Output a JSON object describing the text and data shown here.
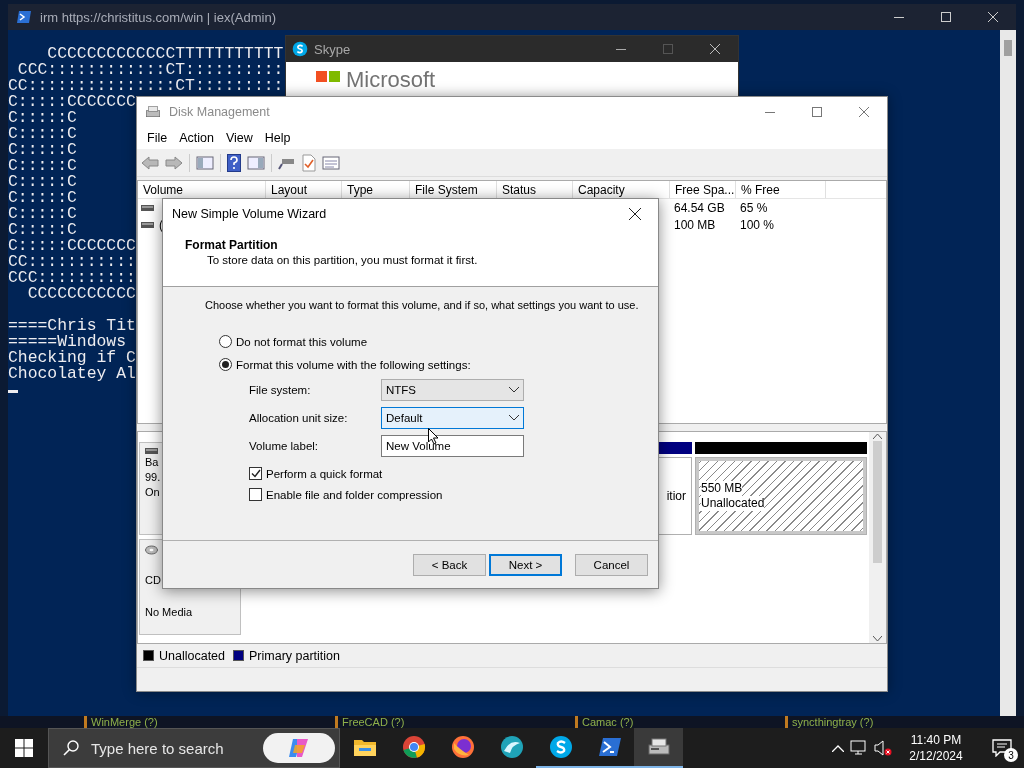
{
  "console": {
    "title": "irm https://christitus.com/win | iex(Admin)",
    "logo_lines": [
      "    CCCCCCCCCCCCCTTTTTTTTTTT",
      " CCC::::::::::::CT::::::::::",
      "CC:::::::::::::::CT:::::::::",
      "C:::::CCCCCCC",
      "C:::::C",
      "C:::::C",
      "C:::::C",
      "C:::::C",
      "C:::::C",
      "C:::::C",
      "C:::::C",
      "C:::::C",
      "C:::::CCCCCCC",
      "CC:::::::::::",
      "CCC::::::::::",
      "  CCCCCCCCCCC"
    ],
    "output_lines": [
      "====Chris Tit",
      "=====Windows",
      "Checking if C",
      "Chocolatey Al"
    ]
  },
  "background_labels": [
    "WinMerge (?)",
    "FreeCAD (?)",
    "Camac (?)",
    "syncthingtray (?)"
  ],
  "skype": {
    "title": "Skype",
    "brand": "Microsoft"
  },
  "disk_management": {
    "title": "Disk Management",
    "menu": [
      "File",
      "Action",
      "View",
      "Help"
    ],
    "columns": [
      "Volume",
      "Layout",
      "Type",
      "File System",
      "Status",
      "Capacity",
      "Free Spa...",
      "% Free"
    ],
    "rows": [
      {
        "free_space": "64.54 GB",
        "percent_free": "65 %"
      },
      {
        "volume": "(",
        "free_space": "100 MB",
        "percent_free": "100 %"
      }
    ],
    "disks": [
      {
        "kind": "disk",
        "label_lines": [
          "Ba",
          "99.",
          "On"
        ],
        "partitions": [
          {
            "kind": "primary",
            "text": [
              "itior"
            ]
          },
          {
            "kind": "unallocated",
            "text": [
              "550 MB",
              "Unallocated"
            ]
          }
        ]
      },
      {
        "kind": "cdrom",
        "label_lines": [
          "CD",
          "No Media"
        ]
      }
    ],
    "legend": [
      {
        "label": "Unallocated",
        "color": "#000000"
      },
      {
        "label": "Primary partition",
        "color": "#000080"
      }
    ]
  },
  "wizard": {
    "title": "New Simple Volume Wizard",
    "heading": "Format Partition",
    "subheading": "To store data on this partition, you must format it first.",
    "prompt": "Choose whether you want to format this volume, and if so, what settings you want to use.",
    "options": [
      {
        "label": "Do not format this volume",
        "selected": false
      },
      {
        "label": "Format this volume with the following settings:",
        "selected": true
      }
    ],
    "fields": [
      {
        "label": "File system:",
        "kind": "select",
        "value": "NTFS",
        "focused": false
      },
      {
        "label": "Allocation unit size:",
        "kind": "select",
        "value": "Default",
        "focused": true
      },
      {
        "label": "Volume label:",
        "kind": "text",
        "value": "New Volume",
        "focused": false
      }
    ],
    "checkboxes": [
      {
        "label": "Perform a quick format",
        "checked": true
      },
      {
        "label": "Enable file and folder compression",
        "checked": false
      }
    ],
    "buttons": [
      {
        "label": "< Back",
        "default": false
      },
      {
        "label": "Next >",
        "default": true
      },
      {
        "label": "Cancel",
        "default": false
      }
    ]
  },
  "taskbar": {
    "search_placeholder": "Type here to search",
    "apps": [
      {
        "kind": "folder",
        "running": false,
        "active": false
      },
      {
        "kind": "chrome",
        "running": false,
        "active": false
      },
      {
        "kind": "firefox",
        "running": false,
        "active": false
      },
      {
        "kind": "wave",
        "running": false,
        "active": false
      },
      {
        "kind": "skype",
        "running": true,
        "active": false
      },
      {
        "kind": "terminal",
        "running": true,
        "active": false
      },
      {
        "kind": "disk",
        "running": true,
        "active": true
      }
    ],
    "time": "11:40 PM",
    "date": "2/12/2024",
    "notifications": "3"
  }
}
